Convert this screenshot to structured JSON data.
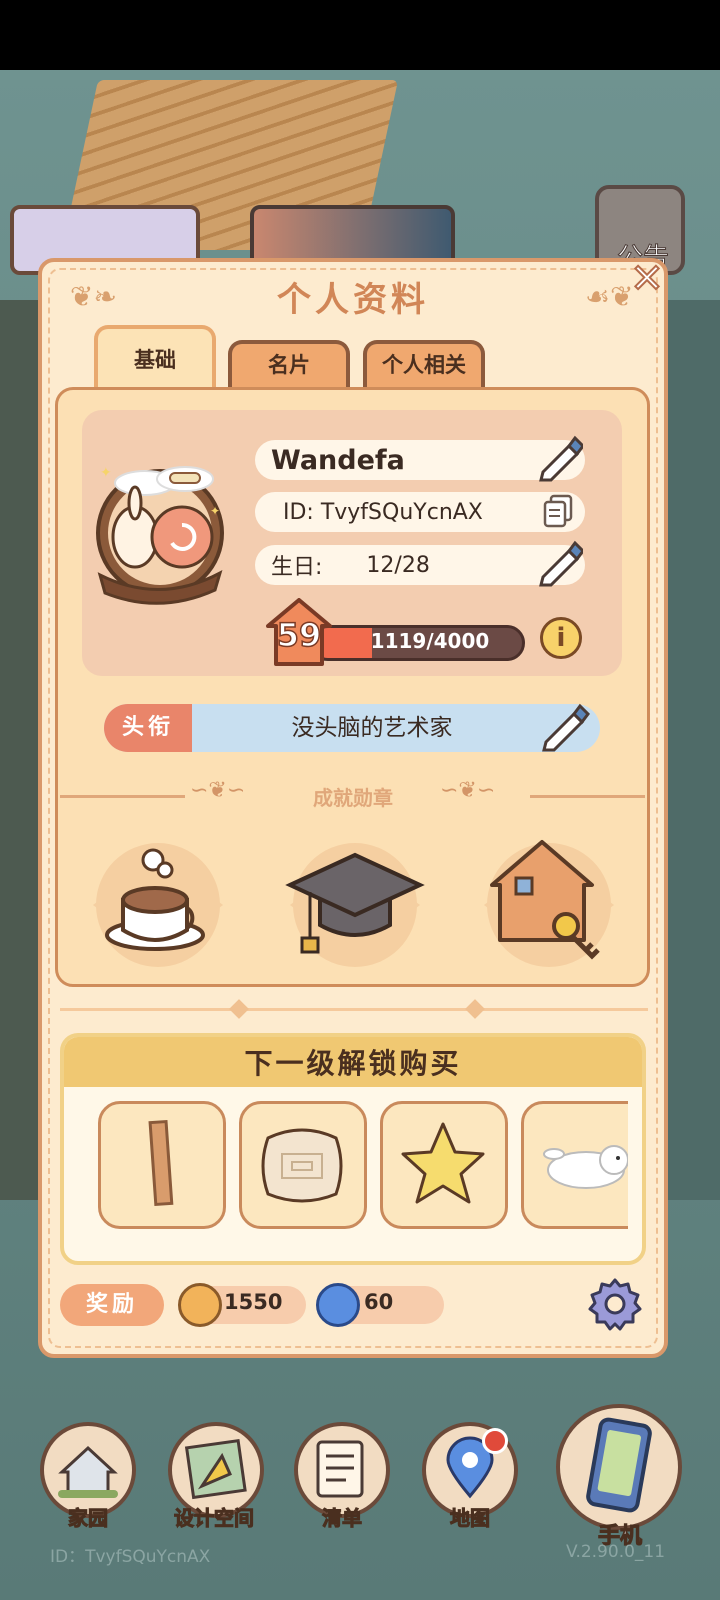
{
  "dialog": {
    "title": "个人资料",
    "close_icon": "close-icon"
  },
  "tabs": [
    {
      "label": "基础",
      "active": true
    },
    {
      "label": "名片",
      "active": false
    },
    {
      "label": "个人相关",
      "active": false
    }
  ],
  "profile": {
    "name": "Wandefa",
    "id_text": "ID: TvyfSQuYcnAX",
    "birthday_label": "生日:",
    "birthday_value": "12/28",
    "level": "59",
    "xp_text": "1119/4000",
    "xp_fraction": 0.28
  },
  "title_row": {
    "tag": "头衔",
    "value": "没头脑的艺术家"
  },
  "achievements": {
    "label": "成就勋章",
    "medals": [
      "coffee-medal-icon",
      "graduation-cap-medal-icon",
      "house-key-medal-icon"
    ]
  },
  "unlock": {
    "header": "下一级解锁购买",
    "items": [
      "wood-plank-icon",
      "patterned-cushion-icon",
      "star-pillow-icon",
      "bunny-plush-icon"
    ]
  },
  "rewards": {
    "label": "奖励",
    "coin_value": "1550",
    "gem_value": "60"
  },
  "background": {
    "notice_text": "公告"
  },
  "nav": [
    {
      "label": "家园",
      "icon": "home-icon"
    },
    {
      "label": "设计空间",
      "icon": "design-icon"
    },
    {
      "label": "清单",
      "icon": "list-icon"
    },
    {
      "label": "地图",
      "icon": "map-pin-icon"
    },
    {
      "label": "手机",
      "icon": "phone-icon"
    }
  ],
  "footer": {
    "id": "ID：TvyfSQuYcnAX",
    "version": "V.2.90.0_11"
  },
  "colors": {
    "accent": "#d18657",
    "xp_fill": "#f26b4e",
    "panel": "#fce0b4"
  }
}
